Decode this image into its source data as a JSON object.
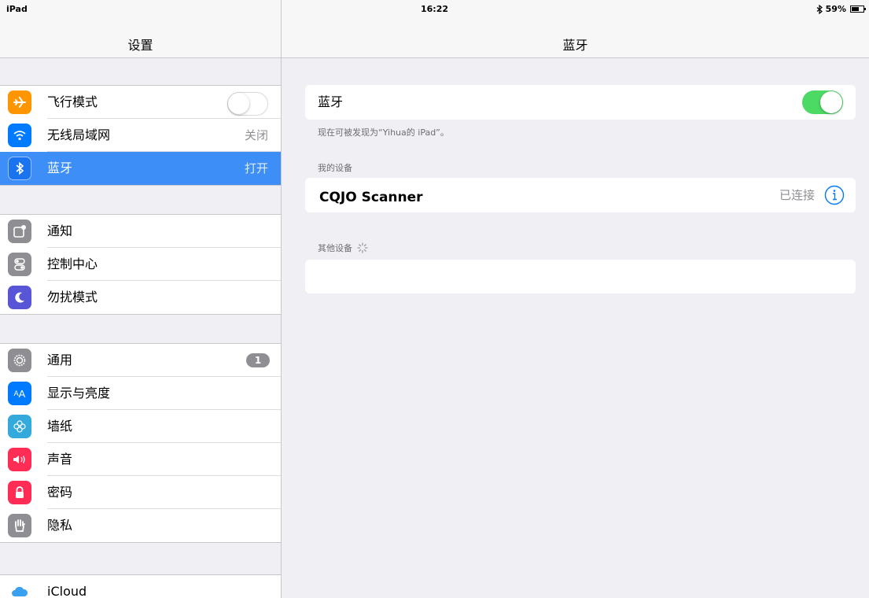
{
  "status_bar": {
    "device": "iPad",
    "time": "16:22",
    "battery": "59%"
  },
  "left": {
    "title": "设置",
    "groups": [
      [
        {
          "label": "飞行模式",
          "icon": "airplane-icon",
          "color": "#ff9500",
          "accessory": "toggle-off"
        },
        {
          "label": "无线局域网",
          "icon": "wifi-icon",
          "color": "#007aff",
          "value": "关闭"
        },
        {
          "label": "蓝牙",
          "icon": "bluetooth-icon",
          "color": "#007aff",
          "value": "打开",
          "selected": true
        }
      ],
      [
        {
          "label": "通知",
          "icon": "notifications-icon",
          "color": "#8e8e93"
        },
        {
          "label": "控制中心",
          "icon": "control-center-icon",
          "color": "#8e8e93"
        },
        {
          "label": "勿扰模式",
          "icon": "moon-icon",
          "color": "#5856d6"
        }
      ],
      [
        {
          "label": "通用",
          "icon": "gear-icon",
          "color": "#8e8e93",
          "badge": "1"
        },
        {
          "label": "显示与亮度",
          "icon": "display-brightness-icon",
          "color": "#007aff"
        },
        {
          "label": "墙纸",
          "icon": "wallpaper-icon",
          "color": "#34aadc"
        },
        {
          "label": "声音",
          "icon": "sound-icon",
          "color": "#ff2d55"
        },
        {
          "label": "密码",
          "icon": "lock-icon",
          "color": "#ff2d55"
        },
        {
          "label": "隐私",
          "icon": "hand-icon",
          "color": "#8e8e93"
        }
      ],
      [
        {
          "label": "iCloud",
          "icon": "icloud-icon",
          "color": "#ffffff"
        }
      ]
    ]
  },
  "right": {
    "title": "蓝牙",
    "bluetooth_label": "蓝牙",
    "bluetooth_on": true,
    "discoverable_note": "现在可被发现为“Yihua的 iPad”。",
    "my_devices_header": "我的设备",
    "devices": [
      {
        "name": "CQJO Scanner",
        "status": "已连接"
      }
    ],
    "other_devices_header": "其他设备"
  },
  "colors": {
    "accent": "#3d8ff7",
    "toggle_on": "#4cd964",
    "info": "#007aff"
  }
}
